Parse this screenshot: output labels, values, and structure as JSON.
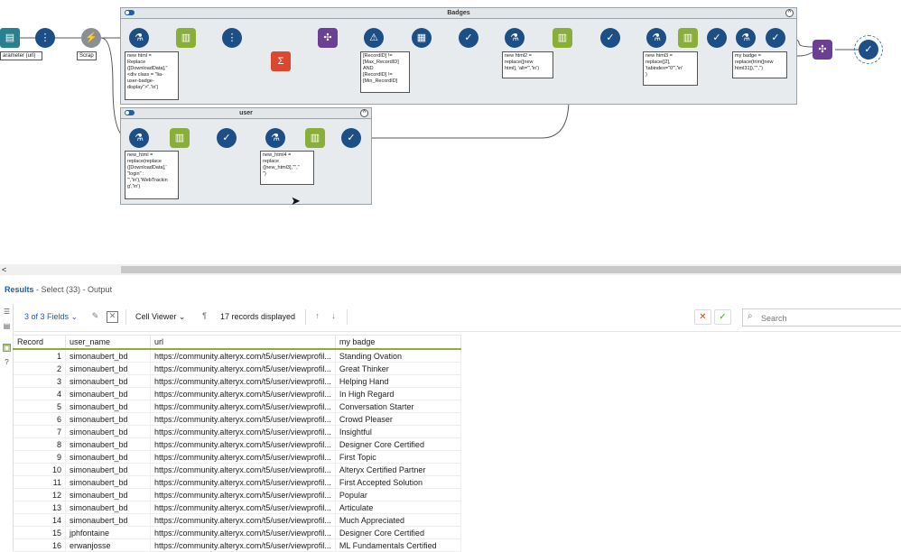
{
  "canvas": {
    "badges_container": {
      "title": "Badges"
    },
    "user_container": {
      "title": "user"
    },
    "labels": {
      "input": "arameter (url)",
      "scrap": "Scrap"
    },
    "annotations": {
      "a1": "new html =\nReplace\n([DownloadData],\"\n<div class = \"lia-\nuser-badge-\ndisplay\">\",'\\n')",
      "a2": "[RecordID] !=\n[Max_RecordID]\nAND\n[RecordID] !=\n[Min_RecordID]",
      "a3": "new html2 =\nreplace([new\nhtml], 'alt=\"','\\n')",
      "a4": "new html3 =\nreplace([2],\n'tabindex=\"0\"','\\n'\n)",
      "a5": "my badge =\nreplace(trim([new\nhtml31]),'\"','')",
      "a6": "new_html =\nreplace(replace\n([DownloadData],'\n\"login\" :\n\"','\\n'),'WebTrackin\ng','\\n')",
      "a7": "new_html4 =\nreplace\n([new_html3],'\"',\"\n\")"
    }
  },
  "results": {
    "title": "Results",
    "subtitle": "- Select (33) - Output",
    "fields_selector": "3 of 3 Fields",
    "viewer": "Cell Viewer",
    "records_displayed": "17 records displayed",
    "search_placeholder": "Search",
    "columns": [
      "Record",
      "user_name",
      "url",
      "my badge"
    ],
    "rows": [
      [
        "1",
        "simonaubert_bd",
        "https://community.alteryx.com/t5/user/viewprofil...",
        "Standing Ovation"
      ],
      [
        "2",
        "simonaubert_bd",
        "https://community.alteryx.com/t5/user/viewprofil...",
        "Great Thinker"
      ],
      [
        "3",
        "simonaubert_bd",
        "https://community.alteryx.com/t5/user/viewprofil...",
        "Helping Hand"
      ],
      [
        "4",
        "simonaubert_bd",
        "https://community.alteryx.com/t5/user/viewprofil...",
        "In High Regard"
      ],
      [
        "5",
        "simonaubert_bd",
        "https://community.alteryx.com/t5/user/viewprofil...",
        "Conversation Starter"
      ],
      [
        "6",
        "simonaubert_bd",
        "https://community.alteryx.com/t5/user/viewprofil...",
        "Crowd Pleaser"
      ],
      [
        "7",
        "simonaubert_bd",
        "https://community.alteryx.com/t5/user/viewprofil...",
        "Insightful"
      ],
      [
        "8",
        "simonaubert_bd",
        "https://community.alteryx.com/t5/user/viewprofil...",
        "Designer Core Certified"
      ],
      [
        "9",
        "simonaubert_bd",
        "https://community.alteryx.com/t5/user/viewprofil...",
        "First Topic"
      ],
      [
        "10",
        "simonaubert_bd",
        "https://community.alteryx.com/t5/user/viewprofil...",
        "Alteryx Certified Partner"
      ],
      [
        "11",
        "simonaubert_bd",
        "https://community.alteryx.com/t5/user/viewprofil...",
        "First Accepted Solution"
      ],
      [
        "12",
        "simonaubert_bd",
        "https://community.alteryx.com/t5/user/viewprofil...",
        "Popular"
      ],
      [
        "13",
        "simonaubert_bd",
        "https://community.alteryx.com/t5/user/viewprofil...",
        "Articulate"
      ],
      [
        "14",
        "simonaubert_bd",
        "https://community.alteryx.com/t5/user/viewprofil...",
        "Much Appreciated"
      ],
      [
        "15",
        "jphfontaine",
        "https://community.alteryx.com/t5/user/viewprofil...",
        "Designer Core Certified"
      ],
      [
        "16",
        "erwanjosse",
        "https://community.alteryx.com/t5/user/viewprofil...",
        "ML Fundamentals Certified"
      ]
    ]
  }
}
